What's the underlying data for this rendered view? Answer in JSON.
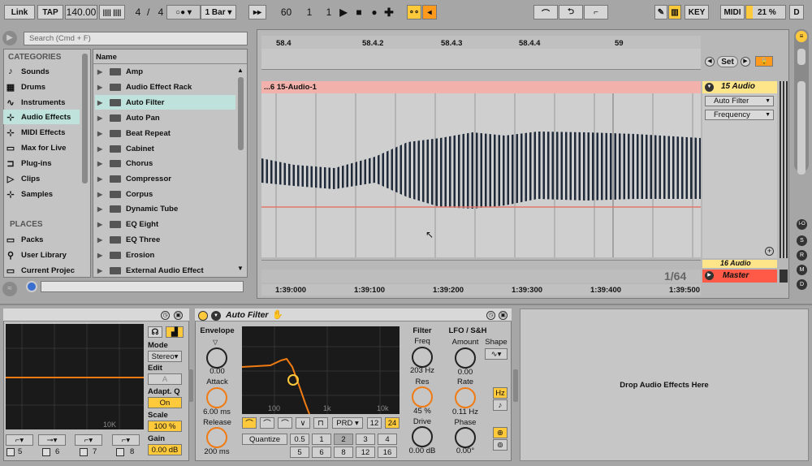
{
  "transport": {
    "link": "Link",
    "tap": "TAP",
    "tempo": "140.00",
    "sig_num": "4",
    "sig_den": "4",
    "quantize": "1 Bar",
    "pos_bar": "60",
    "pos_beat": "1",
    "pos_sixteenth": "1",
    "key": "KEY",
    "midi": "MIDI",
    "cpu": "21 %",
    "disk": "D"
  },
  "browser": {
    "search_placeholder": "Search (Cmd + F)",
    "categories_header": "CATEGORIES",
    "categories": [
      {
        "label": "Sounds",
        "icon": "♪"
      },
      {
        "label": "Drums",
        "icon": "▦"
      },
      {
        "label": "Instruments",
        "icon": "∿"
      },
      {
        "label": "Audio Effects",
        "icon": "⊹"
      },
      {
        "label": "MIDI Effects",
        "icon": "⊹"
      },
      {
        "label": "Max for Live",
        "icon": "▭"
      },
      {
        "label": "Plug-ins",
        "icon": "⊐"
      },
      {
        "label": "Clips",
        "icon": "▷"
      },
      {
        "label": "Samples",
        "icon": "⊹"
      }
    ],
    "places_header": "PLACES",
    "places": [
      {
        "label": "Packs",
        "icon": "▭"
      },
      {
        "label": "User Library",
        "icon": "⚲"
      },
      {
        "label": "Current Projec",
        "icon": "▭"
      }
    ],
    "name_header": "Name",
    "files": [
      "Amp",
      "Audio Effect Rack",
      "Auto Filter",
      "Auto Pan",
      "Beat Repeat",
      "Cabinet",
      "Chorus",
      "Compressor",
      "Corpus",
      "Dynamic Tube",
      "EQ Eight",
      "EQ Three",
      "Erosion",
      "External Audio Effect"
    ],
    "selected_file": "Auto Filter"
  },
  "arrangement": {
    "ruler_top": [
      "58.4",
      "58.4.2",
      "58.4.3",
      "58.4.4",
      "59"
    ],
    "ruler_bottom": [
      "1:39:000",
      "1:39:100",
      "1:39:200",
      "1:39:300",
      "1:39:400",
      "1:39:500"
    ],
    "set_label": "Set",
    "clip_name": "...6 15-Audio-1",
    "track_name": "15 Audio",
    "device_chooser": "Auto Filter",
    "param_chooser": "Frequency",
    "zoom": "1/64",
    "next_track": "16 Audio",
    "master": "Master",
    "side_buttons": [
      "I-O",
      "S",
      "R",
      "M",
      "D"
    ]
  },
  "eq_device": {
    "freq_label": "10K",
    "mode_label": "Mode",
    "mode_value": "Stereo",
    "edit_label": "Edit",
    "edit_value": "A",
    "adaptq_label": "Adapt. Q",
    "adaptq_value": "On",
    "scale_label": "Scale",
    "scale_value": "100 %",
    "gain_label": "Gain",
    "gain_value": "0.00 dB",
    "band_numbers": [
      "5",
      "6",
      "7",
      "8"
    ]
  },
  "auto_filter": {
    "title": "Auto Filter",
    "envelope_header": "Envelope",
    "env_amount": "0.00",
    "attack_label": "Attack",
    "attack_value": "6.00 ms",
    "release_label": "Release",
    "release_value": "200 ms",
    "graph_labels": [
      "100",
      "1k",
      "10k"
    ],
    "filter_header": "Filter",
    "freq_label": "Freq",
    "freq_value": "203 Hz",
    "res_label": "Res",
    "res_value": "45 %",
    "drive_label": "Drive",
    "drive_value": "0.00 dB",
    "circuit": "PRD",
    "slope_12": "12",
    "slope_24": "24",
    "quantize_label": "Quantize",
    "quant_values": [
      "0.5",
      "1",
      "2",
      "3",
      "4",
      "5",
      "6",
      "8",
      "12",
      "16"
    ],
    "lfo_header": "LFO / S&H",
    "amount_label": "Amount",
    "amount_value": "0.00",
    "shape_label": "Shape",
    "rate_label": "Rate",
    "rate_value": "0.11 Hz",
    "phase_label": "Phase",
    "phase_value": "0.00°",
    "hz_label": "Hz"
  },
  "drop_zone": "Drop Audio Effects Here",
  "colors": {
    "accent": "#ffc93c",
    "orange": "#f07b14",
    "selection": "#bfe3dc",
    "clip": "#f2b1ab",
    "master": "#ff5a47",
    "waveform": "#1f2a3a"
  }
}
